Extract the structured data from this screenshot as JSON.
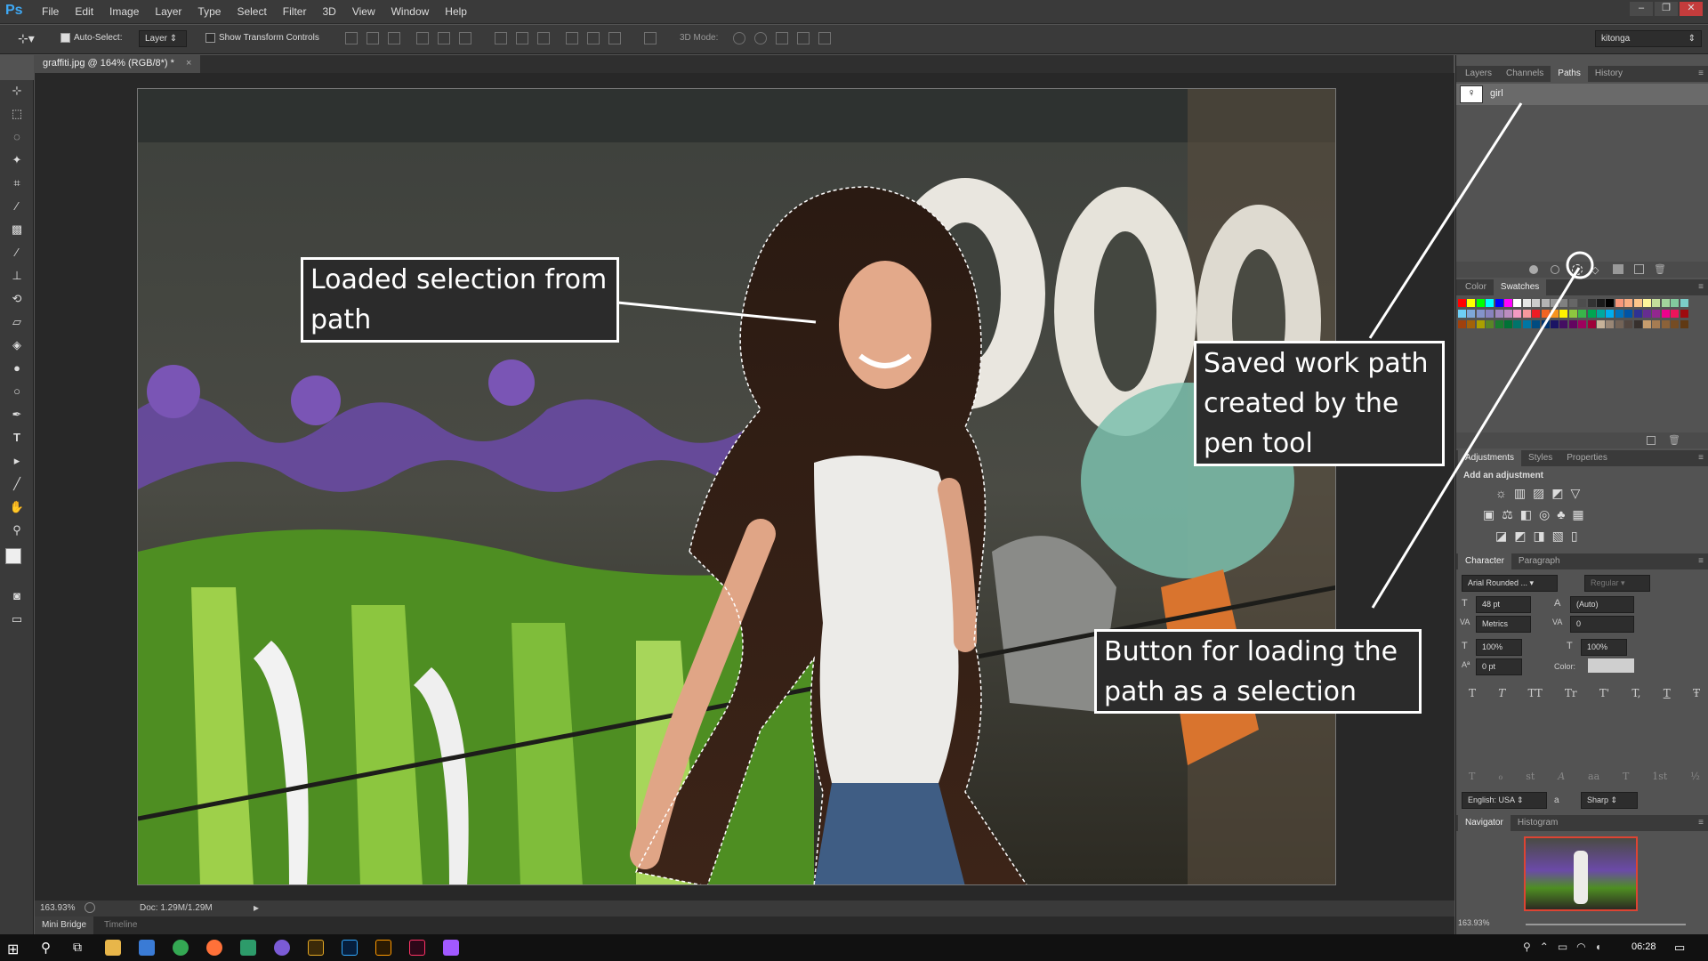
{
  "app": {
    "logo": "Ps"
  },
  "menubar": {
    "items": [
      "File",
      "Edit",
      "Image",
      "Layer",
      "Type",
      "Select",
      "Filter",
      "3D",
      "View",
      "Window",
      "Help"
    ]
  },
  "window_controls": {
    "minimize": "–",
    "restore": "❐",
    "close": "✕"
  },
  "options_bar": {
    "auto_select_label": "Auto-Select:",
    "auto_select_value": "Layer",
    "show_transform_label": "Show Transform Controls",
    "mode_label": "3D Mode:",
    "workspace_value": "kitonga"
  },
  "document": {
    "tab_title": "graffiti.jpg @ 164% (RGB/8*) *",
    "tab_close": "×",
    "zoom": "163.93%",
    "doc_size": "Doc: 1.29M/1.29M"
  },
  "bottom_tabs": [
    "Mini Bridge",
    "Timeline"
  ],
  "panels": {
    "paths": {
      "tabs": [
        "Layers",
        "Channels",
        "Paths",
        "History"
      ],
      "active": "Paths",
      "item_name": "girl"
    },
    "color": {
      "tabs": [
        "Color",
        "Swatches"
      ],
      "active": "Swatches"
    },
    "adjustments": {
      "tabs": [
        "Adjustments",
        "Styles",
        "Properties"
      ],
      "active": "Adjustments",
      "heading": "Add an adjustment"
    },
    "character": {
      "tabs": [
        "Character",
        "Paragraph"
      ],
      "active": "Character",
      "font_family": "Arial Rounded ...",
      "font_style": "Regular",
      "font_size": "48 pt",
      "leading": "(Auto)",
      "kerning": "Metrics",
      "tracking": "0",
      "vertical_scale": "100%",
      "horizontal_scale": "100%",
      "baseline": "0 pt",
      "color_label": "Color:",
      "language": "English: USA",
      "aa_label": "a",
      "antialias": "Sharp",
      "type_buttons": [
        "T",
        "T",
        "TT",
        "Tr",
        "T'",
        "T,",
        "T",
        "Ŧ"
      ],
      "ot_buttons": [
        "fi",
        "ℴ",
        "st",
        "A",
        "aa",
        "T",
        "1st",
        "½"
      ]
    },
    "navigator": {
      "tabs": [
        "Navigator",
        "Histogram"
      ],
      "active": "Navigator",
      "zoom": "163.93%"
    }
  },
  "callouts": {
    "selection": "Loaded selection from path",
    "workpath": "Saved work path created by the pen tool",
    "button": "Button for loading the path as a selection"
  },
  "taskbar": {
    "clock": "06:28"
  },
  "colors": {
    "accent": "#3fa9f5",
    "panel_bg": "#535353",
    "chrome": "#3a3a3a"
  }
}
